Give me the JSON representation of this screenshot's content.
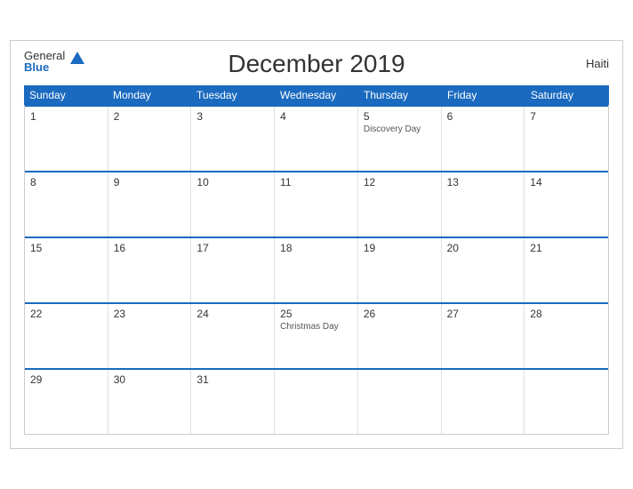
{
  "header": {
    "title": "December 2019",
    "country": "Haiti",
    "logo_general": "General",
    "logo_blue": "Blue"
  },
  "days_of_week": [
    "Sunday",
    "Monday",
    "Tuesday",
    "Wednesday",
    "Thursday",
    "Friday",
    "Saturday"
  ],
  "weeks": [
    [
      {
        "date": "1",
        "holiday": ""
      },
      {
        "date": "2",
        "holiday": ""
      },
      {
        "date": "3",
        "holiday": ""
      },
      {
        "date": "4",
        "holiday": ""
      },
      {
        "date": "5",
        "holiday": "Discovery Day"
      },
      {
        "date": "6",
        "holiday": ""
      },
      {
        "date": "7",
        "holiday": ""
      }
    ],
    [
      {
        "date": "8",
        "holiday": ""
      },
      {
        "date": "9",
        "holiday": ""
      },
      {
        "date": "10",
        "holiday": ""
      },
      {
        "date": "11",
        "holiday": ""
      },
      {
        "date": "12",
        "holiday": ""
      },
      {
        "date": "13",
        "holiday": ""
      },
      {
        "date": "14",
        "holiday": ""
      }
    ],
    [
      {
        "date": "15",
        "holiday": ""
      },
      {
        "date": "16",
        "holiday": ""
      },
      {
        "date": "17",
        "holiday": ""
      },
      {
        "date": "18",
        "holiday": ""
      },
      {
        "date": "19",
        "holiday": ""
      },
      {
        "date": "20",
        "holiday": ""
      },
      {
        "date": "21",
        "holiday": ""
      }
    ],
    [
      {
        "date": "22",
        "holiday": ""
      },
      {
        "date": "23",
        "holiday": ""
      },
      {
        "date": "24",
        "holiday": ""
      },
      {
        "date": "25",
        "holiday": "Christmas Day"
      },
      {
        "date": "26",
        "holiday": ""
      },
      {
        "date": "27",
        "holiday": ""
      },
      {
        "date": "28",
        "holiday": ""
      }
    ],
    [
      {
        "date": "29",
        "holiday": ""
      },
      {
        "date": "30",
        "holiday": ""
      },
      {
        "date": "31",
        "holiday": ""
      },
      {
        "date": "",
        "holiday": ""
      },
      {
        "date": "",
        "holiday": ""
      },
      {
        "date": "",
        "holiday": ""
      },
      {
        "date": "",
        "holiday": ""
      }
    ]
  ]
}
